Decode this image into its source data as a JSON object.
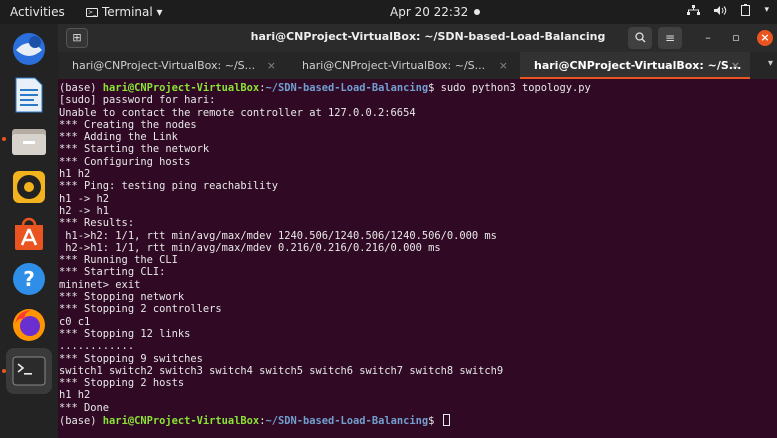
{
  "topbar": {
    "activities": "Activities",
    "app_name": "Terminal ▾",
    "clock": "Apr 20  22:32"
  },
  "dock": {
    "items": [
      {
        "name": "thunderbird",
        "active": false
      },
      {
        "name": "libreoffice-writer",
        "active": false
      },
      {
        "name": "files",
        "active": false
      },
      {
        "name": "rhythmbox",
        "active": false
      },
      {
        "name": "ubuntu-software",
        "active": false
      },
      {
        "name": "help",
        "active": false
      },
      {
        "name": "firefox",
        "active": false
      },
      {
        "name": "terminal",
        "active": true
      }
    ]
  },
  "window": {
    "title": "hari@CNProject-VirtualBox: ~/SDN-based-Load-Balancing",
    "tabs": [
      {
        "label": "hari@CNProject-VirtualBox: ~/S...",
        "active": false
      },
      {
        "label": "hari@CNProject-VirtualBox: ~/S...",
        "active": false
      },
      {
        "label": "hari@CNProject-VirtualBox: ~/S...",
        "active": true
      }
    ]
  },
  "prompt": {
    "env": "(base) ",
    "user_host": "hari@CNProject-VirtualBox",
    "sep": ":",
    "path": "~/SDN-based-Load-Balancing",
    "symbol": "$ "
  },
  "terminal": {
    "command": "sudo python3 topology.py",
    "output": [
      "[sudo] password for hari:",
      "Unable to contact the remote controller at 127.0.0.2:6654",
      "*** Creating the nodes",
      "*** Adding the Link",
      "*** Starting the network",
      "*** Configuring hosts",
      "h1 h2",
      "*** Ping: testing ping reachability",
      "h1 -> h2",
      "h2 -> h1",
      "*** Results:",
      " h1->h2: 1/1, rtt min/avg/max/mdev 1240.506/1240.506/1240.506/0.000 ms",
      " h2->h1: 1/1, rtt min/avg/max/mdev 0.216/0.216/0.216/0.000 ms",
      "*** Running the CLI",
      "*** Starting CLI:",
      "mininet> exit",
      "*** Stopping network",
      "*** Stopping 2 controllers",
      "c0 c1",
      "*** Stopping 12 links",
      "............",
      "*** Stopping 9 switches",
      "switch1 switch2 switch3 switch4 switch5 switch6 switch7 switch8 switch9",
      "*** Stopping 2 hosts",
      "h1 h2",
      "*** Done"
    ]
  },
  "colors": {
    "terminal_bg": "#300a24",
    "prompt_user": "#8ae234",
    "prompt_path": "#729fcf",
    "accent": "#e95420"
  }
}
